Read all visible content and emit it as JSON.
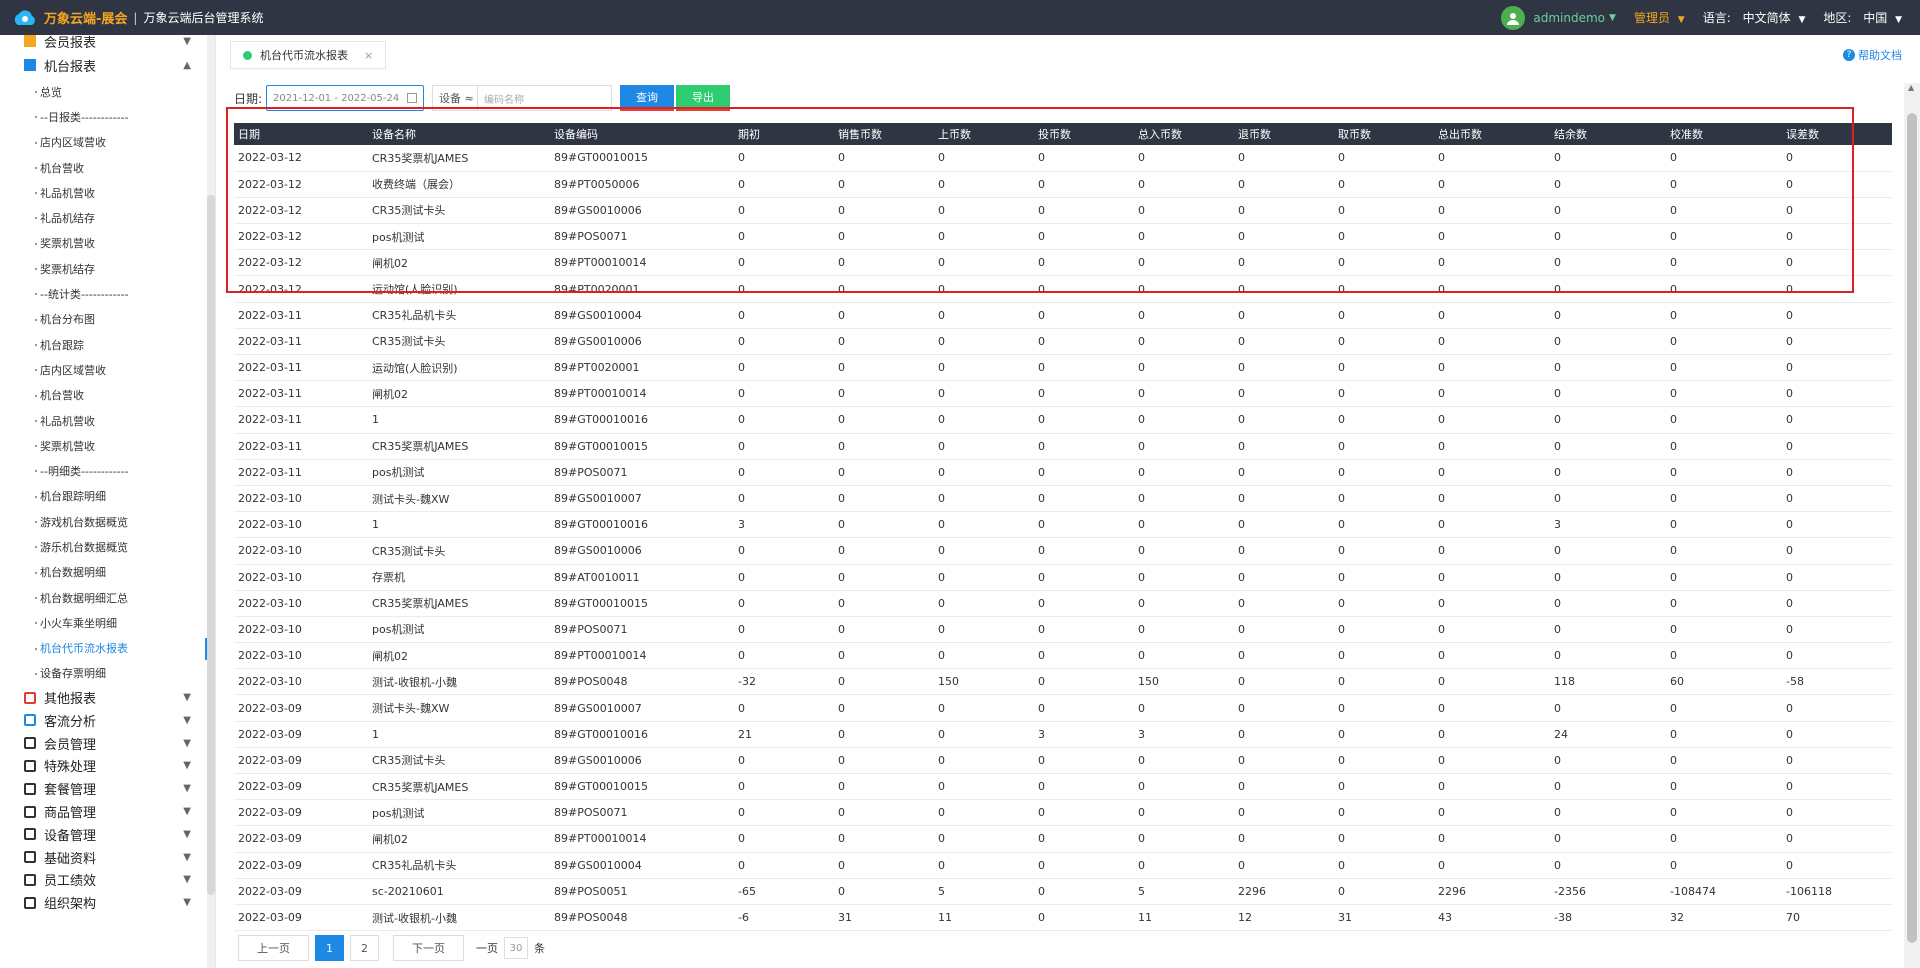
{
  "header": {
    "brand": "万象云端-展会",
    "separator": "|",
    "system_name": "万象云端后台管理系统",
    "username": "admindemo",
    "role": "管理员",
    "language_label": "语言:",
    "language_value": "中文简体",
    "region_label": "地区:",
    "region_value": "中国"
  },
  "sidebar": {
    "top_group": "会员报表",
    "current_group": "机台报表",
    "items": [
      "总览",
      "--日报类------------",
      "店内区域营收",
      "机台营收",
      "礼品机营收",
      "礼品机结存",
      "奖票机营收",
      "奖票机结存",
      "--统计类------------",
      "机台分布图",
      "机台跟踪",
      "店内区域营收",
      "机台营收",
      "礼品机营收",
      "奖票机营收",
      "--明细类------------",
      "机台跟踪明细",
      "游戏机台数据概览",
      "游乐机台数据概览",
      "机台数据明细",
      "机台数据明细汇总",
      "小火车乘坐明细",
      "机台代币流水报表",
      "设备存票明细"
    ],
    "active_index": 22,
    "groups": [
      "其他报表",
      "客流分析",
      "会员管理",
      "特殊处理",
      "套餐管理",
      "商品管理",
      "设备管理",
      "基础资料",
      "员工绩效",
      "组织架构"
    ]
  },
  "tab": {
    "label": "机台代币流水报表",
    "close": "×"
  },
  "help": {
    "label": "帮助文档",
    "icon": "?"
  },
  "filter": {
    "date_label": "日期:",
    "date_value": "2021-12-01 - 2022-05-24",
    "device_select": "设备 ≈",
    "code_placeholder": "编码名称",
    "query_label": "查询",
    "export_label": "导出"
  },
  "table": {
    "columns": [
      "日期",
      "设备名称",
      "设备编码",
      "期初",
      "销售币数",
      "上币数",
      "投币数",
      "总入币数",
      "退币数",
      "取币数",
      "总出币数",
      "结余数",
      "校准数",
      "误差数"
    ],
    "rows": [
      [
        "2022-03-12",
        "CR35奖票机JAMES",
        "89#GT00010015",
        "0",
        "0",
        "0",
        "0",
        "0",
        "0",
        "0",
        "0",
        "0",
        "0",
        "0"
      ],
      [
        "2022-03-12",
        "收费终端（展会）",
        "89#PT0050006",
        "0",
        "0",
        "0",
        "0",
        "0",
        "0",
        "0",
        "0",
        "0",
        "0",
        "0"
      ],
      [
        "2022-03-12",
        "CR35测试卡头",
        "89#GS0010006",
        "0",
        "0",
        "0",
        "0",
        "0",
        "0",
        "0",
        "0",
        "0",
        "0",
        "0"
      ],
      [
        "2022-03-12",
        "pos机测试",
        "89#POS0071",
        "0",
        "0",
        "0",
        "0",
        "0",
        "0",
        "0",
        "0",
        "0",
        "0",
        "0"
      ],
      [
        "2022-03-12",
        "闸机02",
        "89#PT00010014",
        "0",
        "0",
        "0",
        "0",
        "0",
        "0",
        "0",
        "0",
        "0",
        "0",
        "0"
      ],
      [
        "2022-03-12",
        "运动馆(人脸识别)",
        "89#PT0020001",
        "0",
        "0",
        "0",
        "0",
        "0",
        "0",
        "0",
        "0",
        "0",
        "0",
        "0"
      ],
      [
        "2022-03-11",
        "CR35礼品机卡头",
        "89#GS0010004",
        "0",
        "0",
        "0",
        "0",
        "0",
        "0",
        "0",
        "0",
        "0",
        "0",
        "0"
      ],
      [
        "2022-03-11",
        "CR35测试卡头",
        "89#GS0010006",
        "0",
        "0",
        "0",
        "0",
        "0",
        "0",
        "0",
        "0",
        "0",
        "0",
        "0"
      ],
      [
        "2022-03-11",
        "运动馆(人脸识别)",
        "89#PT0020001",
        "0",
        "0",
        "0",
        "0",
        "0",
        "0",
        "0",
        "0",
        "0",
        "0",
        "0"
      ],
      [
        "2022-03-11",
        "闸机02",
        "89#PT00010014",
        "0",
        "0",
        "0",
        "0",
        "0",
        "0",
        "0",
        "0",
        "0",
        "0",
        "0"
      ],
      [
        "2022-03-11",
        "1",
        "89#GT00010016",
        "0",
        "0",
        "0",
        "0",
        "0",
        "0",
        "0",
        "0",
        "0",
        "0",
        "0"
      ],
      [
        "2022-03-11",
        "CR35奖票机JAMES",
        "89#GT00010015",
        "0",
        "0",
        "0",
        "0",
        "0",
        "0",
        "0",
        "0",
        "0",
        "0",
        "0"
      ],
      [
        "2022-03-11",
        "pos机测试",
        "89#POS0071",
        "0",
        "0",
        "0",
        "0",
        "0",
        "0",
        "0",
        "0",
        "0",
        "0",
        "0"
      ],
      [
        "2022-03-10",
        "测试卡头-魏XW",
        "89#GS0010007",
        "0",
        "0",
        "0",
        "0",
        "0",
        "0",
        "0",
        "0",
        "0",
        "0",
        "0"
      ],
      [
        "2022-03-10",
        "1",
        "89#GT00010016",
        "3",
        "0",
        "0",
        "0",
        "0",
        "0",
        "0",
        "0",
        "3",
        "0",
        "0"
      ],
      [
        "2022-03-10",
        "CR35测试卡头",
        "89#GS0010006",
        "0",
        "0",
        "0",
        "0",
        "0",
        "0",
        "0",
        "0",
        "0",
        "0",
        "0"
      ],
      [
        "2022-03-10",
        "存票机",
        "89#AT0010011",
        "0",
        "0",
        "0",
        "0",
        "0",
        "0",
        "0",
        "0",
        "0",
        "0",
        "0"
      ],
      [
        "2022-03-10",
        "CR35奖票机JAMES",
        "89#GT00010015",
        "0",
        "0",
        "0",
        "0",
        "0",
        "0",
        "0",
        "0",
        "0",
        "0",
        "0"
      ],
      [
        "2022-03-10",
        "pos机测试",
        "89#POS0071",
        "0",
        "0",
        "0",
        "0",
        "0",
        "0",
        "0",
        "0",
        "0",
        "0",
        "0"
      ],
      [
        "2022-03-10",
        "闸机02",
        "89#PT00010014",
        "0",
        "0",
        "0",
        "0",
        "0",
        "0",
        "0",
        "0",
        "0",
        "0",
        "0"
      ],
      [
        "2022-03-10",
        "测试-收银机-小魏",
        "89#POS0048",
        "-32",
        "0",
        "150",
        "0",
        "150",
        "0",
        "0",
        "0",
        "118",
        "60",
        "-58"
      ],
      [
        "2022-03-09",
        "测试卡头-魏XW",
        "89#GS0010007",
        "0",
        "0",
        "0",
        "0",
        "0",
        "0",
        "0",
        "0",
        "0",
        "0",
        "0"
      ],
      [
        "2022-03-09",
        "1",
        "89#GT00010016",
        "21",
        "0",
        "0",
        "3",
        "3",
        "0",
        "0",
        "0",
        "24",
        "0",
        "0"
      ],
      [
        "2022-03-09",
        "CR35测试卡头",
        "89#GS0010006",
        "0",
        "0",
        "0",
        "0",
        "0",
        "0",
        "0",
        "0",
        "0",
        "0",
        "0"
      ],
      [
        "2022-03-09",
        "CR35奖票机JAMES",
        "89#GT00010015",
        "0",
        "0",
        "0",
        "0",
        "0",
        "0",
        "0",
        "0",
        "0",
        "0",
        "0"
      ],
      [
        "2022-03-09",
        "pos机测试",
        "89#POS0071",
        "0",
        "0",
        "0",
        "0",
        "0",
        "0",
        "0",
        "0",
        "0",
        "0",
        "0"
      ],
      [
        "2022-03-09",
        "闸机02",
        "89#PT00010014",
        "0",
        "0",
        "0",
        "0",
        "0",
        "0",
        "0",
        "0",
        "0",
        "0",
        "0"
      ],
      [
        "2022-03-09",
        "CR35礼品机卡头",
        "89#GS0010004",
        "0",
        "0",
        "0",
        "0",
        "0",
        "0",
        "0",
        "0",
        "0",
        "0",
        "0"
      ],
      [
        "2022-03-09",
        "sc-20210601",
        "89#POS0051",
        "-65",
        "0",
        "5",
        "0",
        "5",
        "2296",
        "0",
        "2296",
        "-2356",
        "-108474",
        "-106118"
      ],
      [
        "2022-03-09",
        "测试-收银机-小魏",
        "89#POS0048",
        "-6",
        "31",
        "11",
        "0",
        "11",
        "12",
        "31",
        "43",
        "-38",
        "32",
        "70"
      ]
    ]
  },
  "pager": {
    "prev": "上一页",
    "pages": [
      "1",
      "2"
    ],
    "current": "1",
    "next": "下一页",
    "per_page_label": "一页",
    "per_page_value": "30",
    "unit": "条"
  },
  "colors": {
    "accent": "#1e88e5",
    "export": "#2ecc71",
    "header_bg": "#2f3542",
    "brand": "#f5a623",
    "highlight_box": "#e02020"
  }
}
